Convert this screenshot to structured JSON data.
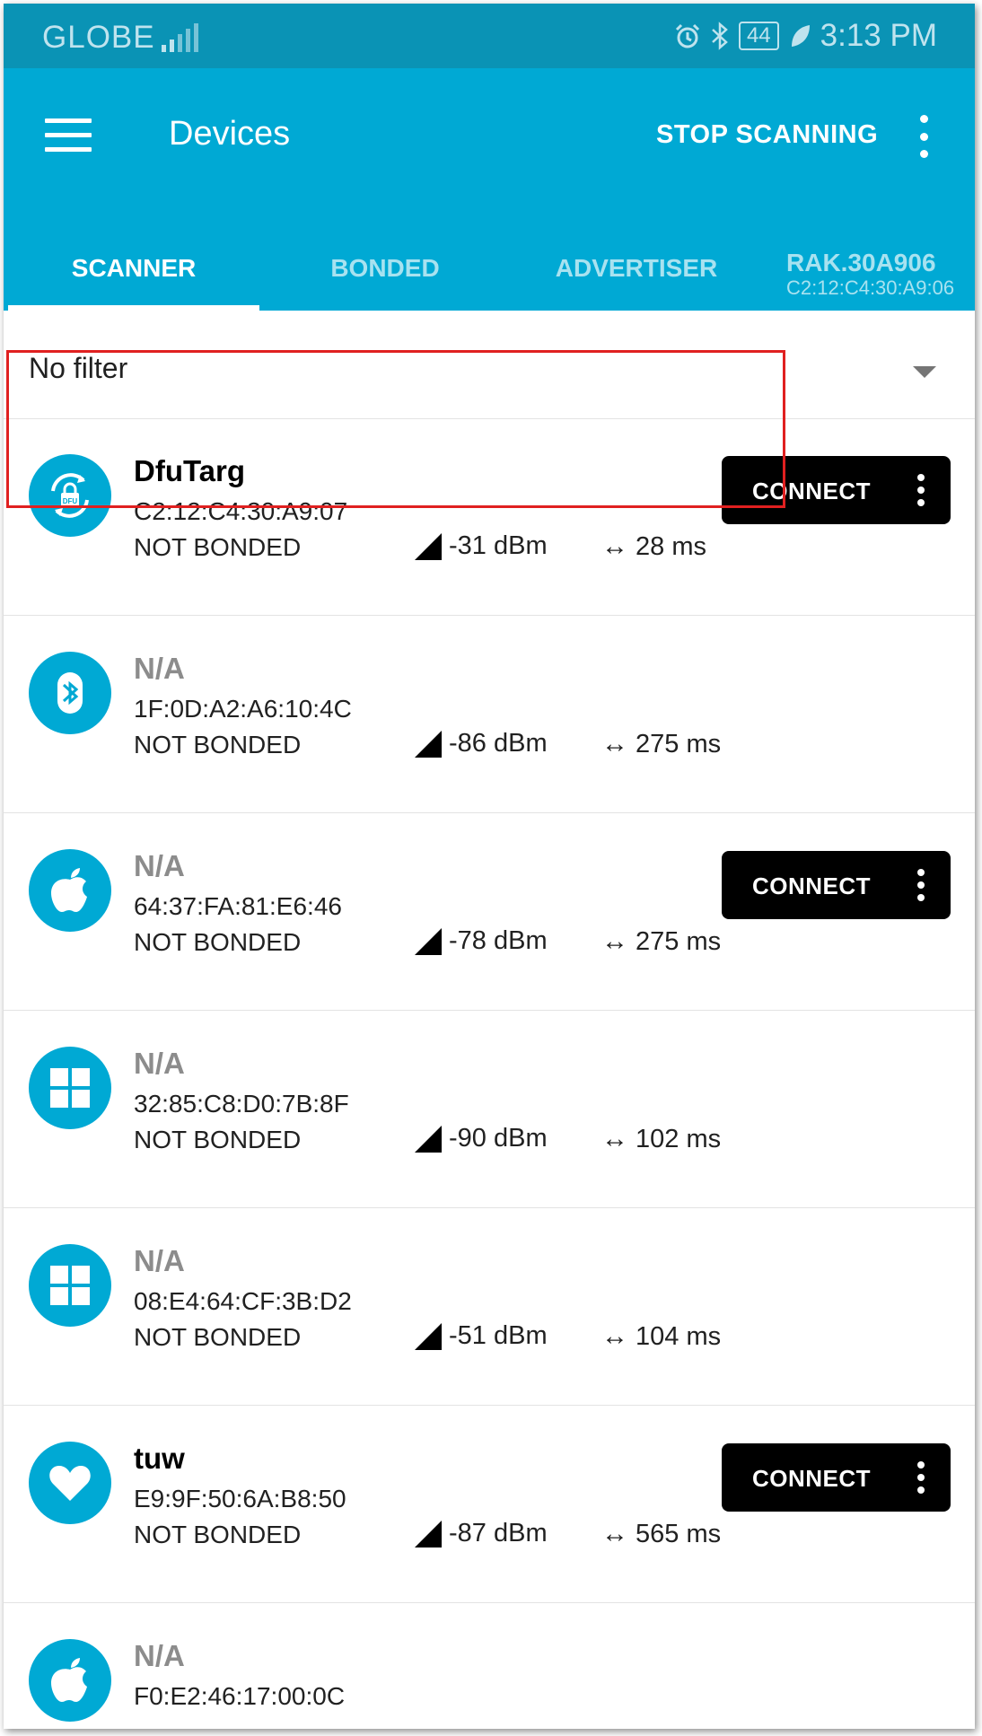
{
  "status_bar": {
    "carrier": "GLOBE",
    "battery": "44",
    "time": "3:13 PM",
    "icons": [
      "signal-icon",
      "alarm-icon",
      "bluetooth-icon",
      "battery-icon",
      "leaf-icon"
    ]
  },
  "toolbar": {
    "title": "Devices",
    "stop_scanning": "STOP SCANNING",
    "color": "#00a9d4"
  },
  "tabs": {
    "scanner": "SCANNER",
    "bonded": "BONDED",
    "advertiser": "ADVERTISER",
    "device_name": "RAK.30A906",
    "device_mac": "C2:12:C4:30:A9:06"
  },
  "filter": {
    "label": "No filter"
  },
  "connect_label": "CONNECT",
  "devices": [
    {
      "name": "DfuTarg",
      "address": "C2:12:C4:30:A9:07",
      "bond": "NOT BONDED",
      "rssi": "-31 dBm",
      "interval": "28 ms",
      "icon": "dfu-icon",
      "connect": true
    },
    {
      "name": "N/A",
      "address": "1F:0D:A2:A6:10:4C",
      "bond": "NOT BONDED",
      "rssi": "-86 dBm",
      "interval": "275 ms",
      "icon": "bluetooth-icon",
      "connect": false
    },
    {
      "name": "N/A",
      "address": "64:37:FA:81:E6:46",
      "bond": "NOT BONDED",
      "rssi": "-78 dBm",
      "interval": "275 ms",
      "icon": "apple-icon",
      "connect": true
    },
    {
      "name": "N/A",
      "address": "32:85:C8:D0:7B:8F",
      "bond": "NOT BONDED",
      "rssi": "-90 dBm",
      "interval": "102 ms",
      "icon": "windows-icon",
      "connect": false
    },
    {
      "name": "N/A",
      "address": "08:E4:64:CF:3B:D2",
      "bond": "NOT BONDED",
      "rssi": "-51 dBm",
      "interval": "104 ms",
      "icon": "windows-icon",
      "connect": false
    },
    {
      "name": "tuw",
      "address": "E9:9F:50:6A:B8:50",
      "bond": "NOT BONDED",
      "rssi": "-87 dBm",
      "interval": "565 ms",
      "icon": "heart-icon",
      "connect": true
    },
    {
      "name": "N/A",
      "address": "F0:E2:46:17:00:0C",
      "bond": "",
      "rssi": "",
      "interval": "",
      "icon": "apple-icon",
      "connect": false
    }
  ]
}
